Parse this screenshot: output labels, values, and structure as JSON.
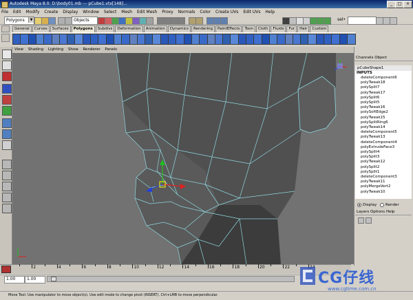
{
  "window": {
    "title": "Autodesk Maya 8.0: D:\\body01.mb    ---    pCube1.vtx[148]..."
  },
  "menubar": {
    "items": [
      "File",
      "Edit",
      "Modify",
      "Create",
      "Display",
      "Window",
      "Select",
      "Mesh",
      "Edit Mesh",
      "Proxy",
      "Normals",
      "Color",
      "Create UVs",
      "Edit UVs",
      "Help"
    ]
  },
  "statusline": {
    "menuset": "Polygons",
    "objects_label": "Objects",
    "sel_label": "sel•"
  },
  "shelf": {
    "tabs": [
      "General",
      "Curves",
      "Surfaces",
      "Polygons",
      "Subdivs",
      "Deformation",
      "Animation",
      "Dynamics",
      "Rendering",
      "PaintEffects",
      "Toon",
      "Cloth",
      "Fluids",
      "Fur",
      "Hair",
      "Custom"
    ],
    "active_tab": "Polygons"
  },
  "panel": {
    "menu": [
      "View",
      "Shading",
      "Lighting",
      "Show",
      "Renderer",
      "Panels"
    ]
  },
  "channelbox": {
    "header": [
      "Channels",
      "Object"
    ],
    "object_name": "pCubeShape1",
    "inputs_label": "INPUTS",
    "inputs": [
      "deleteComponent6",
      "polyTweak18",
      "polySplit7",
      "polyTweak17",
      "polySplit6",
      "polySplit5",
      "polyTweak16",
      "polySoftEdge2",
      "polyTweak15",
      "polySplitRing6",
      "polyTweak14",
      "deleteComponent5",
      "polyTweak13",
      "deleteComponent4",
      "polyExtrudeFace3",
      "polySplit4",
      "polySplit3",
      "polyTweak12",
      "polySplit2",
      "polySplit1",
      "deleteComponent3",
      "polyTweak11",
      "polyMergeVert2",
      "polyTweak10"
    ]
  },
  "layers": {
    "display_label": "Display",
    "render_label": "Render",
    "menu": [
      "Layers",
      "Options",
      "Help"
    ]
  },
  "timeslider": {
    "tick_labels": [
      "2",
      "4",
      "6",
      "8",
      "10",
      "12",
      "14",
      "16",
      "18",
      "20",
      "22",
      "24"
    ]
  },
  "range": {
    "start": "1.00",
    "playback_start": "1.00"
  },
  "helpline": {
    "text": "Move Tool: Use manipulator to move object(s). Use edit mode to change pivot (INSERT). Ctrl+LMB to move perpendicular."
  },
  "watermark": {
    "text": "CG仔线",
    "url": "www.cgtime.com.cn"
  },
  "colors": {
    "titlebar": "#0a246a",
    "viewport_bg": "#6f6f6f",
    "wire": "#8fd8e0",
    "selected_item": "#000080"
  }
}
